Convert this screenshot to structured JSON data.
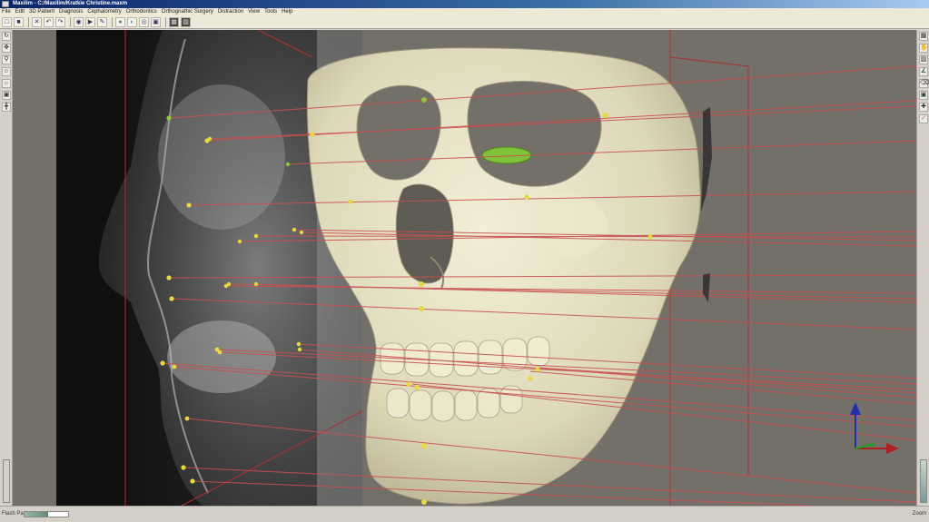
{
  "window": {
    "title": "Maxilim - C:/Maxilim/Kratkie Christine.maxm"
  },
  "menu": [
    "File",
    "Edit",
    "3D Patient",
    "Diagnosis",
    "Cephalometry",
    "Orthodontics",
    "Orthognathic Surgery",
    "Distraction",
    "View",
    "Tools",
    "Help"
  ],
  "toolbar": {
    "buttons": [
      "open-icon",
      "save-icon",
      "cut-icon",
      "undo-icon",
      "redo-icon",
      "render-icon",
      "select-icon",
      "paint-icon",
      "sphere-icon",
      "sphere-alt-icon",
      "eye-icon",
      "layer-icon",
      "grid-icon",
      "dark-icon"
    ]
  },
  "left_toolbar": {
    "buttons": [
      "rotate-icon",
      "pan-icon",
      "zoom-icon",
      "face-icon",
      "light-icon",
      "camera-icon",
      "axis-icon"
    ]
  },
  "right_toolbar": {
    "buttons": [
      "view-front-icon",
      "view-hand-icon",
      "view-side-icon",
      "measure-icon",
      "erase-icon",
      "photo-icon",
      "crosshair-icon",
      "flag-icon"
    ]
  },
  "status": {
    "left_label": "Flash Part",
    "progress": 0.55,
    "right_label": "Zoom"
  },
  "colors": {
    "viewport_bg": "#736f69",
    "bone": "#e8e4c8",
    "landmark": "#e8d83a",
    "landmark_green": "#8cc83a",
    "projection_line": "#c84a4a",
    "axis_z": "#2030b0",
    "axis_x": "#b02020",
    "axis_y": "#20a020"
  }
}
